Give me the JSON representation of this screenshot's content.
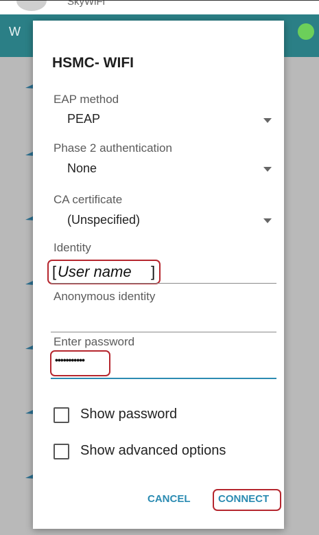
{
  "background": {
    "top_text": "SkyWiFi",
    "bar_title": "W",
    "toggle_color": "#6ccf5a",
    "bar_color": "#2b7f86"
  },
  "dialog": {
    "title": "HSMC- WIFI",
    "eap_method": {
      "label": "EAP method",
      "value": "PEAP"
    },
    "phase2": {
      "label": "Phase 2 authentication",
      "value": "None"
    },
    "ca_certificate": {
      "label": "CA certificate",
      "value": "(Unspecified)"
    },
    "identity": {
      "label": "Identity",
      "value_open": "[",
      "value_text": "User name",
      "value_close": "]"
    },
    "anonymous_identity": {
      "label": "Anonymous identity",
      "value": ""
    },
    "password": {
      "label": "Enter password",
      "value": "•••••••••••"
    },
    "show_password": {
      "label": "Show password",
      "checked": false
    },
    "show_advanced": {
      "label": "Show advanced options",
      "checked": false
    },
    "cancel_label": "CANCEL",
    "connect_label": "CONNECT",
    "accent_color": "#2b8bb2",
    "highlight_color": "#b5262e"
  }
}
